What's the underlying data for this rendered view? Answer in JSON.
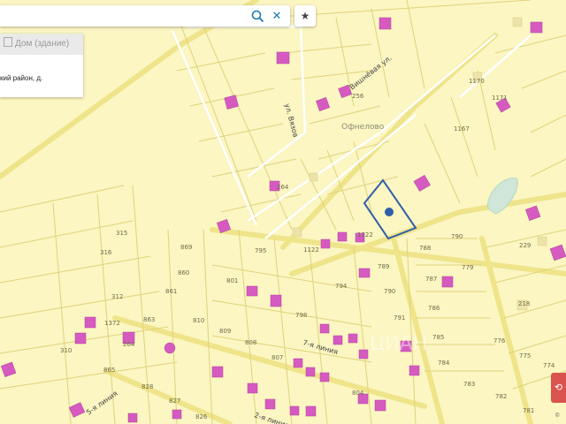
{
  "search": {
    "value": "",
    "placeholder": ""
  },
  "card": {
    "type_label": "Дом (здание)",
    "address_fragment": "кий район, д."
  },
  "map": {
    "place_name": "Офнелово",
    "streets": [
      "ул. Вязов",
      "Вишнёвая ул.",
      "7-я линия",
      "2-я линия",
      "5-я линия"
    ],
    "parcel_numbers": [
      "1170",
      "1171",
      "1167",
      "264",
      "1122",
      "1222",
      "790",
      "788",
      "789",
      "779",
      "787",
      "786",
      "785",
      "784",
      "783",
      "782",
      "781",
      "776",
      "775",
      "774",
      "229",
      "218",
      "315",
      "316",
      "312",
      "310",
      "869",
      "860",
      "861",
      "863",
      "865",
      "828",
      "827",
      "826",
      "795",
      "801",
      "810",
      "809",
      "808",
      "807",
      "798",
      "794",
      "790",
      "791",
      "804",
      "1372",
      "256",
      "264"
    ]
  },
  "colors": {
    "land": "#fbf6c2",
    "parcel_line": "#e0d27a",
    "road": "#f4ea8a",
    "building": "#d65bc1",
    "selection": "#2f5fa8",
    "water": "#cfe6d8"
  },
  "watermark": "ЦИАН",
  "copyright": "©"
}
